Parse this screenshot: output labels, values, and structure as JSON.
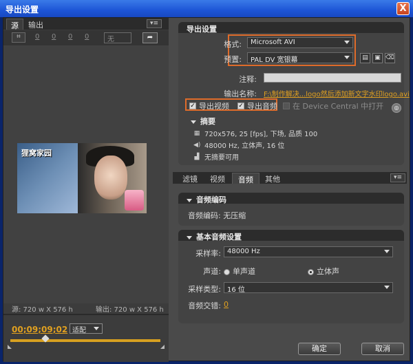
{
  "window": {
    "title": "导出设置",
    "close_glyph": "X"
  },
  "left_tabs": [
    {
      "label": "源"
    },
    {
      "label": "输出"
    }
  ],
  "left_toolbar": {
    "crop_values": [
      "0",
      "0",
      "0",
      "0"
    ],
    "aspect": "无"
  },
  "preview": {
    "logo_text": "狸窝家园",
    "source_size": "源: 720 w X 576 h",
    "output_size": "输出: 720 w X 576 h"
  },
  "timeline": {
    "timecode": "00;09;09;02",
    "fit": "适配"
  },
  "export_settings": {
    "heading": "导出设置",
    "format_label": "格式:",
    "format_value": "Microsoft AVI",
    "preset_label": "预置:",
    "preset_value": "PAL DV 宽银幕",
    "comment_label": "注释:",
    "comment_value": "",
    "output_name_label": "输出名称:",
    "output_name_value": "F:\\制作解决...logo然后添加新文字水印logo.avi",
    "export_video": "导出视频",
    "export_audio": "导出音频",
    "device_central": "在 Device Central 中打开",
    "summary_heading": "摘要",
    "summary_lines": [
      "720x576, 25 [fps], 下场, 品质 100",
      "48000 Hz, 立体声, 16 位",
      "无摘要可用"
    ]
  },
  "right_tabs": [
    {
      "label": "滤镜"
    },
    {
      "label": "视频"
    },
    {
      "label": "音频"
    },
    {
      "label": "其他"
    }
  ],
  "audio_codec": {
    "heading": "音频编码",
    "line": "音频编码: 无压缩"
  },
  "basic_audio": {
    "heading": "基本音频设置",
    "sample_rate_label": "采样率:",
    "sample_rate_value": "48000 Hz",
    "channel_label": "声道:",
    "mono": "单声道",
    "stereo": "立体声",
    "sample_type_label": "采样类型:",
    "sample_type_value": "16 位",
    "interleave_label": "音频交错:",
    "interleave_value": "0"
  },
  "buttons": {
    "ok": "确定",
    "cancel": "取消"
  }
}
